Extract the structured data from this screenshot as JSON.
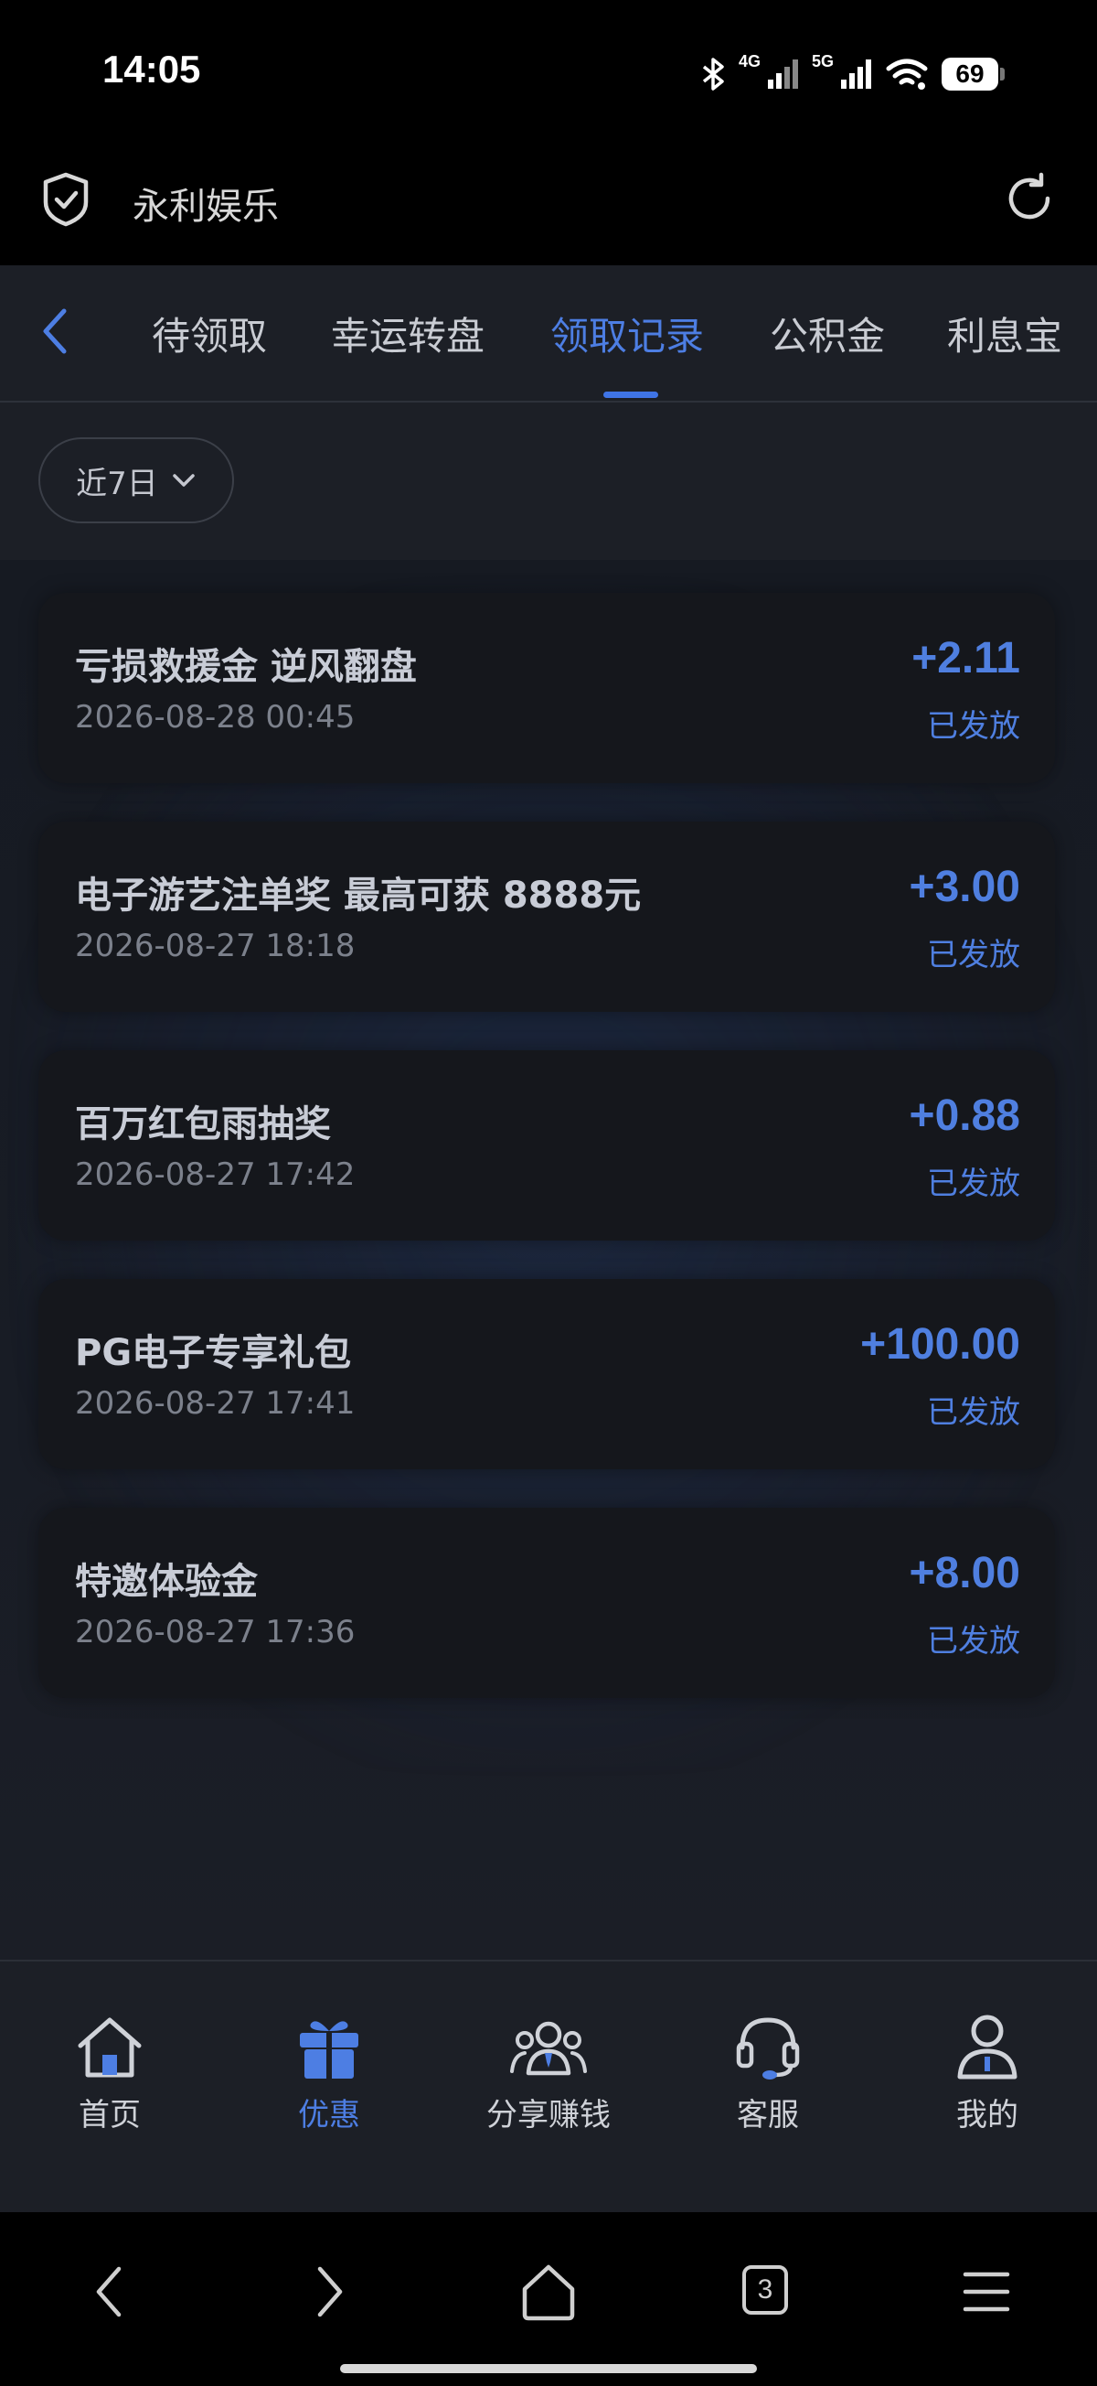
{
  "status_bar": {
    "time": "14:05",
    "network_1": "4G",
    "network_2": "5G",
    "battery": "69"
  },
  "browser": {
    "site_title": "永利娱乐"
  },
  "tabs": [
    {
      "label": "待领取"
    },
    {
      "label": "幸运转盘"
    },
    {
      "label": "领取记录",
      "active": true
    },
    {
      "label": "公积金"
    },
    {
      "label": "利息宝"
    }
  ],
  "filter": {
    "selected": "近7日"
  },
  "records": [
    {
      "title": "亏损救援金 逆风翻盘",
      "date": "2026-08-28 00:45",
      "amount": "+2.11",
      "status": "已发放"
    },
    {
      "title": "电子游艺注单奖 最高可获 8888元",
      "date": "2026-08-27 18:18",
      "amount": "+3.00",
      "status": "已发放"
    },
    {
      "title": "百万红包雨抽奖",
      "date": "2026-08-27 17:42",
      "amount": "+0.88",
      "status": "已发放"
    },
    {
      "title": "PG电子专享礼包",
      "date": "2026-08-27 17:41",
      "amount": "+100.00",
      "status": "已发放"
    },
    {
      "title": "特邀体验金",
      "date": "2026-08-27 17:36",
      "amount": "+8.00",
      "status": "已发放"
    }
  ],
  "bottom_nav": [
    {
      "label": "首页",
      "icon": "home-icon"
    },
    {
      "label": "优惠",
      "icon": "gift-icon",
      "active": true
    },
    {
      "label": "分享赚钱",
      "icon": "share-people-icon"
    },
    {
      "label": "客服",
      "icon": "headset-icon"
    },
    {
      "label": "我的",
      "icon": "user-icon"
    }
  ],
  "system_nav": {
    "tab_count": "3"
  },
  "colors": {
    "accent": "#4d7ee3",
    "background": "#1c1f26",
    "card": "#15171c"
  }
}
